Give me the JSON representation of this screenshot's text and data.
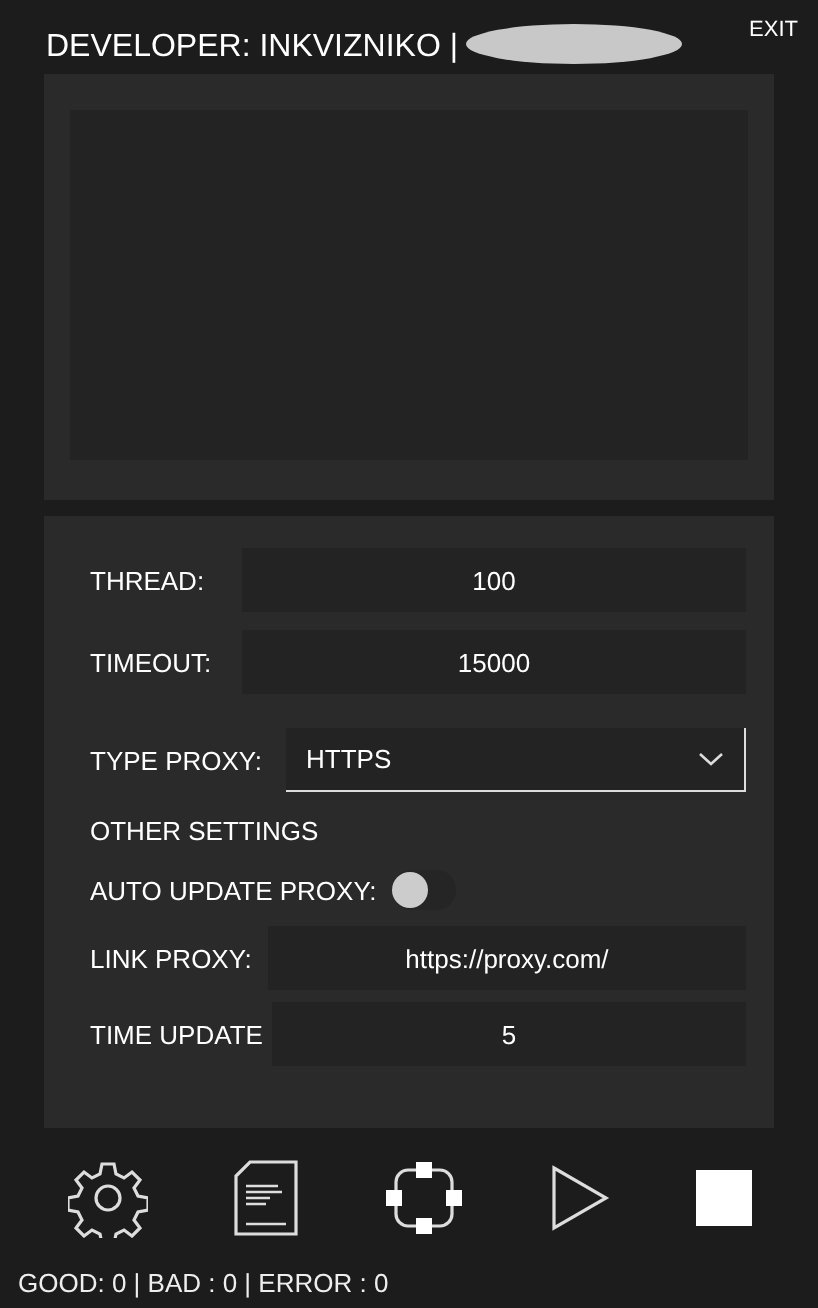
{
  "window": {
    "title": "DEVELOPER: INKVIZNIKO |",
    "exit": "EXIT"
  },
  "settings": {
    "thread": {
      "label": "THREAD:",
      "value": "100"
    },
    "timeout": {
      "label": "TIMEOUT:",
      "value": "15000"
    },
    "type_proxy": {
      "label": "TYPE PROXY:",
      "value": "HTTPS"
    },
    "section": "OTHER SETTINGS",
    "auto_update": {
      "label": "AUTO UPDATE PROXY:",
      "on": false
    },
    "link_proxy": {
      "label": "LINK PROXY:",
      "value": "https://proxy.com/"
    },
    "time_update": {
      "label": "TIME UPDATE",
      "value": "5"
    }
  },
  "toolbar": [
    {
      "kind": "settings"
    },
    {
      "kind": "document"
    },
    {
      "kind": "network"
    },
    {
      "kind": "play"
    },
    {
      "kind": "stop"
    }
  ],
  "status_bar": "GOOD: 0 | BAD : 0 | ERROR : 0"
}
